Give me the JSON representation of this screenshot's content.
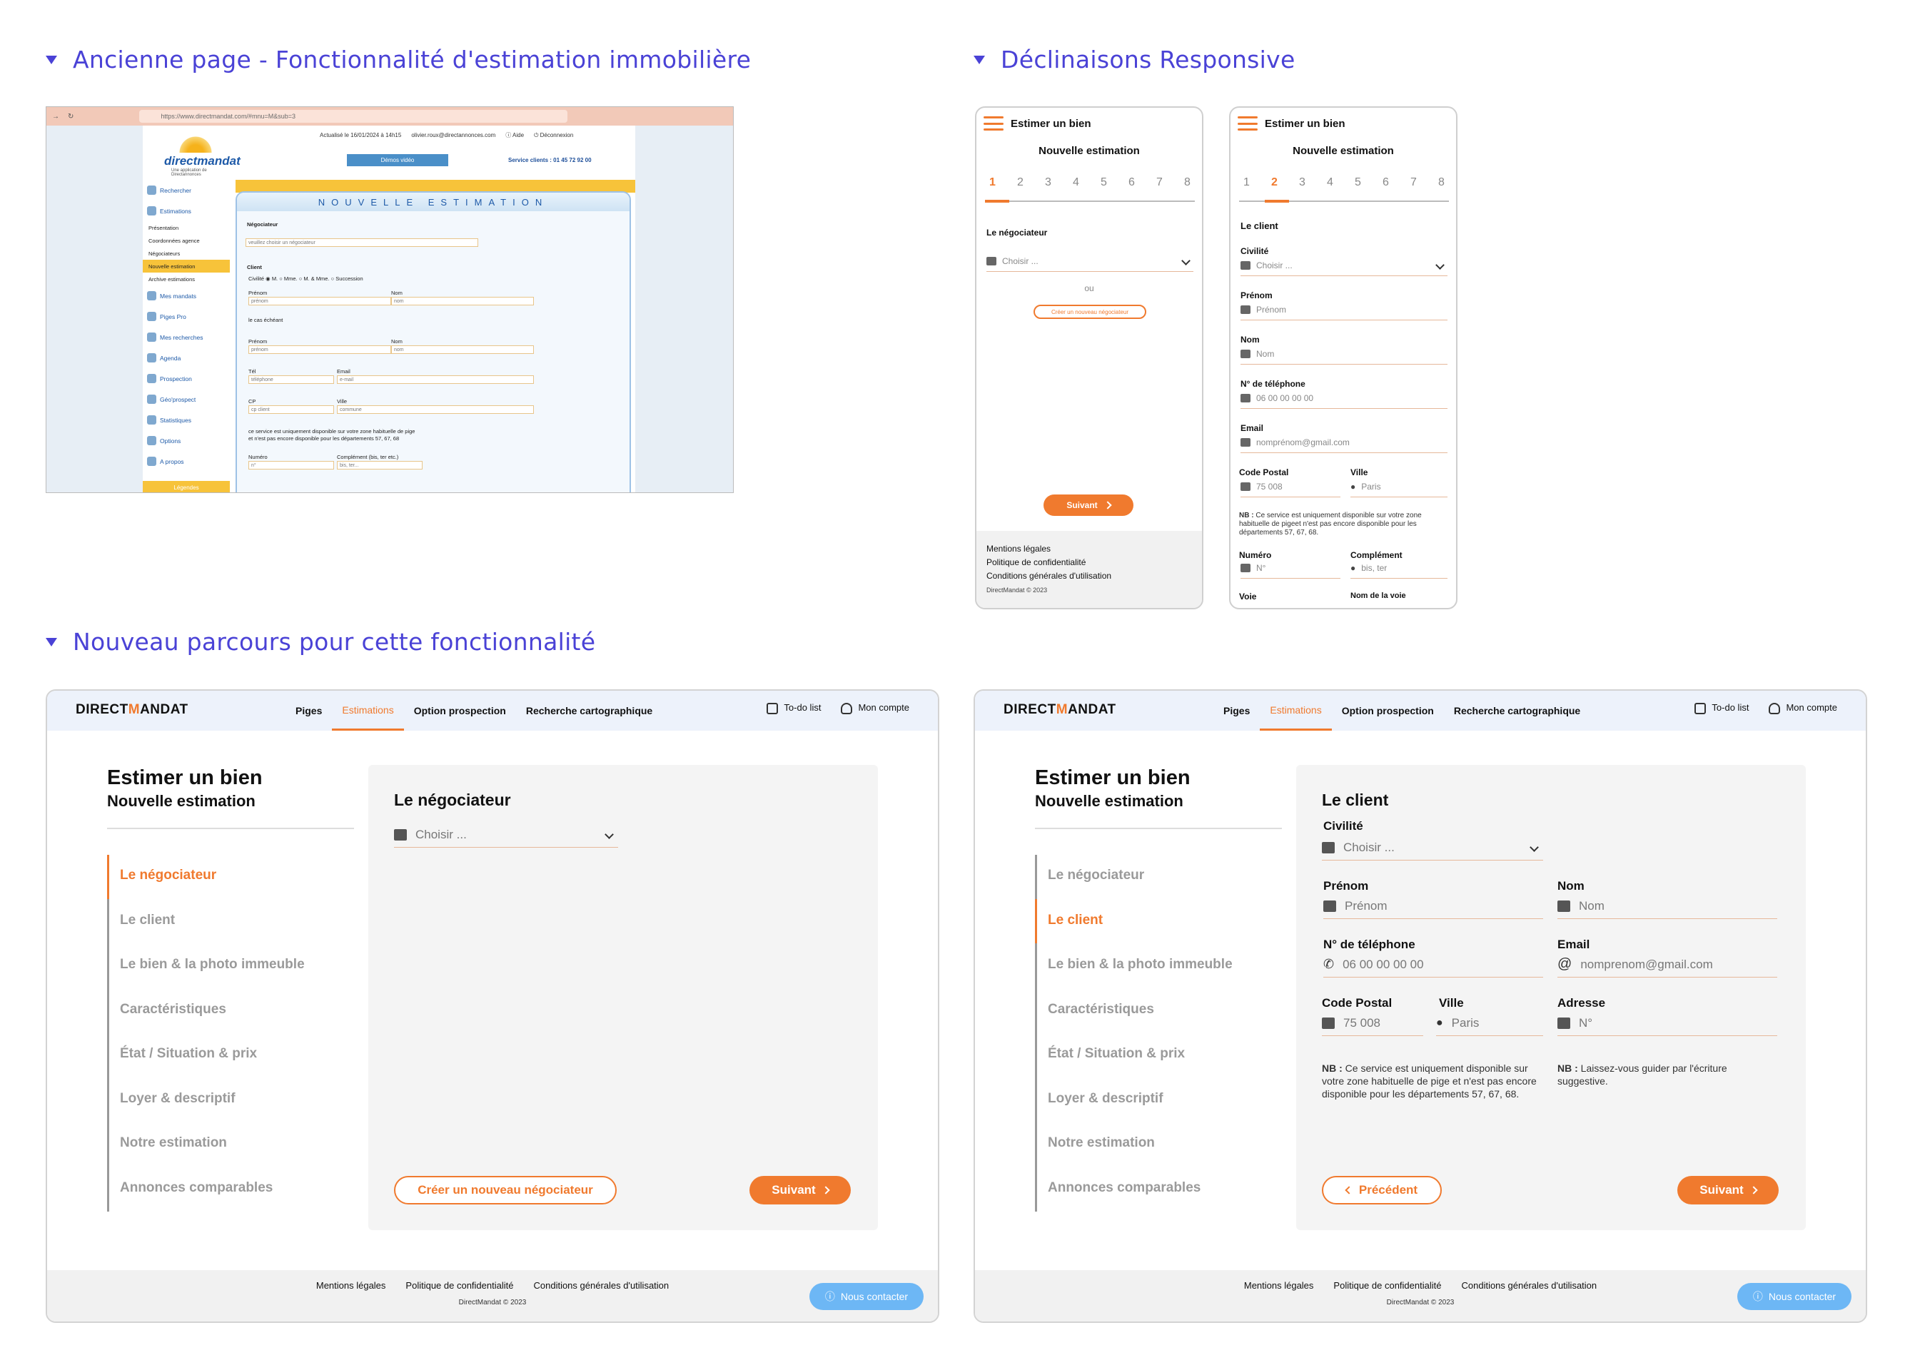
{
  "sections": {
    "old_title": "Ancienne page - Fonctionnalité d'estimation immobilière",
    "responsive_title": "Déclinaisons Responsive",
    "new_title": "Nouveau parcours pour cette fonctionnalité"
  },
  "old_page": {
    "url": "https://www.directmandat.com/#mnu=M&sub=3",
    "brand": "directmandat",
    "brand_tagline": "Une application de Directannonces",
    "updated": "Actualisé le 16/01/2024 à 14h15",
    "email": "olivier.roux@directannonces.com",
    "help": "Aide",
    "logout": "Déconnexion",
    "demos": "Démos vidéo",
    "service": "Service clients : 01 45 72 92 00",
    "sidebar": [
      "Rechercher",
      "Estimations"
    ],
    "sidebar_sub": [
      "Présentation",
      "Coordonnées agence",
      "Négociateurs",
      "Nouvelle estimation",
      "Archive estimations"
    ],
    "sidebar_more": [
      "Mes mandats",
      "Piges Pro",
      "Mes recherches",
      "Agenda",
      "Prospection",
      "Géo'prospect",
      "Statistiques",
      "Options",
      "A propos"
    ],
    "legende": "Légendes",
    "form_title": "NOUVELLE ESTIMATION",
    "negociateur_label": "Négociateur",
    "negociateur_select": "veuillez choisir un négociateur",
    "client_label": "Client",
    "civilite": "Civilité",
    "civ_options": [
      "M.",
      "Mme.",
      "M. & Mme.",
      "Succession"
    ],
    "prenom": "Prénom",
    "nom": "Nom",
    "prenom_ph": "prénom",
    "nom_ph": "nom",
    "cas": "le cas échéant",
    "tel": "Tél",
    "tel_ph": "téléphone",
    "email_label": "Email",
    "email_ph": "e-mail",
    "cp": "CP",
    "cp_ph": "cp client",
    "ville": "Ville",
    "ville_ph": "commune",
    "service_note": "ce service est uniquement disponible sur votre zone habituelle de pige",
    "service_note2": "et n'est pas encore disponible pour les départements 57, 67, 68",
    "numero": "Numéro",
    "complement": "Complément (bis, ter etc.)",
    "numero_ph": "n°",
    "complement_ph": "bis, ter..."
  },
  "mobile": {
    "title": "Estimer un bien",
    "subtitle": "Nouvelle estimation",
    "steps": [
      "1",
      "2",
      "3",
      "4",
      "5",
      "6",
      "7",
      "8"
    ],
    "m1": {
      "section": "Le négociateur",
      "select_ph": "Choisir ...",
      "ou": "ou",
      "create": "Créer un nouveau négociateur",
      "next": "Suivant",
      "footer": [
        "Mentions légales",
        "Politique de confidentialité",
        "Conditions générales d'utilisation"
      ],
      "copy": "DirectMandat © 2023"
    },
    "m2": {
      "section": "Le client",
      "civilite": "Civilité",
      "civ_ph": "Choisir ...",
      "prenom": "Prénom",
      "prenom_ph": "Prénom",
      "nom": "Nom",
      "nom_ph": "Nom",
      "tel": "N° de téléphone",
      "tel_ph": "06 00 00 00 00",
      "email": "Email",
      "email_ph": "nomprénom@gmail.com",
      "cp": "Code Postal",
      "cp_ph": "75 008",
      "ville": "Ville",
      "ville_ph": "Paris",
      "nb_strong": "NB :",
      "nb": " Ce service est uniquement disponible sur votre zone habituelle de pigeet n'est pas encore disponible pour les départements 57, 67, 68.",
      "numero": "Numéro",
      "numero_ph": "N°",
      "complement": "Complément",
      "complement_ph": "bis, ter",
      "voie": "Voie",
      "nom_voie": "Nom de la voie"
    }
  },
  "desktop": {
    "brand_a": "DIRECT",
    "brand_m": "M",
    "brand_b": "ANDAT",
    "menu": [
      "Piges",
      "Estimations",
      "Option prospection",
      "Recherche cartographique"
    ],
    "todo": "To-do list",
    "account": "Mon compte",
    "title": "Estimer un bien",
    "subtitle": "Nouvelle estimation",
    "steps": [
      "Le négociateur",
      "Le client",
      "Le bien & la photo immeuble",
      "Caractéristiques",
      "État / Situation & prix",
      "Loyer & descriptif",
      "Notre estimation",
      "Annonces comparables"
    ],
    "d1": {
      "section": "Le négociateur",
      "select_ph": "Choisir ...",
      "create": "Créer un nouveau négociateur",
      "next": "Suivant"
    },
    "d2": {
      "section": "Le client",
      "civilite": "Civilité",
      "civ_ph": "Choisir ...",
      "prenom": "Prénom",
      "prenom_ph": "Prénom",
      "nom": "Nom",
      "nom_ph": "Nom",
      "tel": "N° de téléphone",
      "tel_ph": "06 00 00 00 00",
      "email": "Email",
      "email_ph": "nomprenom@gmail.com",
      "cp": "Code Postal",
      "cp_ph": "75 008",
      "ville": "Ville",
      "ville_ph": "Paris",
      "adresse": "Adresse",
      "adresse_ph": "N°",
      "nb_strong": "NB :",
      "nb1": " Ce service est uniquement disponible sur votre zone habituelle de pige et n'est pas encore disponible pour les départements 57, 67, 68.",
      "nb2": " Laissez-vous guider par l'écriture suggestive.",
      "prev": "Précédent",
      "next": "Suivant"
    },
    "footer": [
      "Mentions légales",
      "Politique de confidentialité",
      "Conditions générales d'utilisation"
    ],
    "copy": "DirectMandat © 2023",
    "contact": "Nous contacter"
  }
}
